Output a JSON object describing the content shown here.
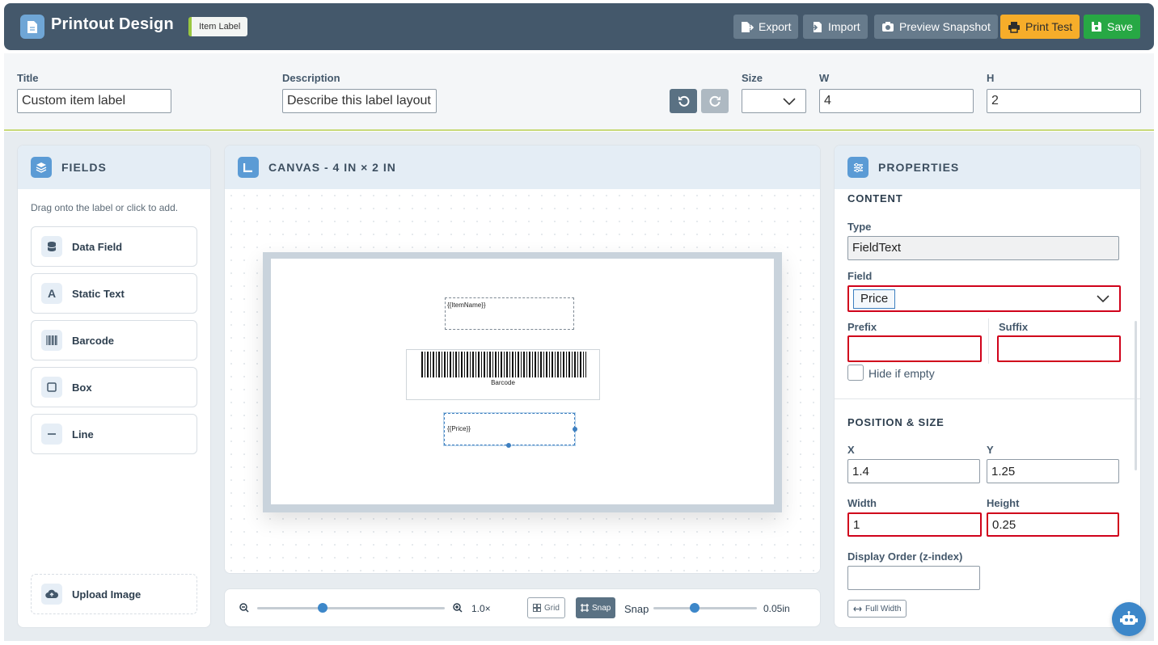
{
  "header": {
    "title": "Printout Design",
    "badge": "Item Label",
    "buttons": {
      "export": "Export",
      "import": "Import",
      "preview": "Preview Snapshot",
      "print_test": "Print Test",
      "save": "Save"
    }
  },
  "form": {
    "title_label": "Title",
    "title_value": "Custom item label",
    "description_label": "Description",
    "description_placeholder": "Describe this label layout",
    "size_label": "Size",
    "size_value": "",
    "w_label": "W",
    "w_value": "4",
    "h_label": "H",
    "h_value": "2"
  },
  "fields_panel": {
    "title": "FIELDS",
    "hint": "Drag onto the label or click to add.",
    "items": [
      {
        "label": "Data Field",
        "icon": "database-icon"
      },
      {
        "label": "Static Text",
        "icon": "text-a-icon"
      },
      {
        "label": "Barcode",
        "icon": "barcode-icon"
      },
      {
        "label": "Box",
        "icon": "square-icon"
      },
      {
        "label": "Line",
        "icon": "line-icon"
      }
    ],
    "upload": "Upload Image"
  },
  "canvas_panel": {
    "title": "CANVAS - 4 IN × 2 IN",
    "elements": {
      "item_name": "{{ItemName}}",
      "barcode": "Barcode",
      "price": "{{Price}}"
    }
  },
  "zoom_bar": {
    "zoom_value": "1.0×",
    "zoom_level": 0.35,
    "grid": "Grid",
    "snap_toggle": "Snap",
    "snap_label": "Snap",
    "snap_value": "0.05in",
    "snap_level": 0.4
  },
  "properties": {
    "title": "PROPERTIES",
    "content_section": "CONTENT",
    "type_label": "Type",
    "type_value": "FieldText",
    "field_label": "Field",
    "field_value": "Price",
    "prefix_label": "Prefix",
    "prefix_value": "",
    "suffix_label": "Suffix",
    "suffix_value": "",
    "hide_if_empty": "Hide if empty",
    "position_section": "POSITION & SIZE",
    "x_label": "X",
    "x_value": "1.4",
    "y_label": "Y",
    "y_value": "1.25",
    "width_label": "Width",
    "width_value": "1",
    "height_label": "Height",
    "height_value": "0.25",
    "z_label": "Display Order (z-index)",
    "z_value": "",
    "full_width": "Full Width"
  },
  "colors": {
    "header_bg": "#44586b",
    "accent": "#5b9bd5",
    "warning": "#f6ad2a",
    "success": "#27a844",
    "highlight": "#d0021b"
  }
}
